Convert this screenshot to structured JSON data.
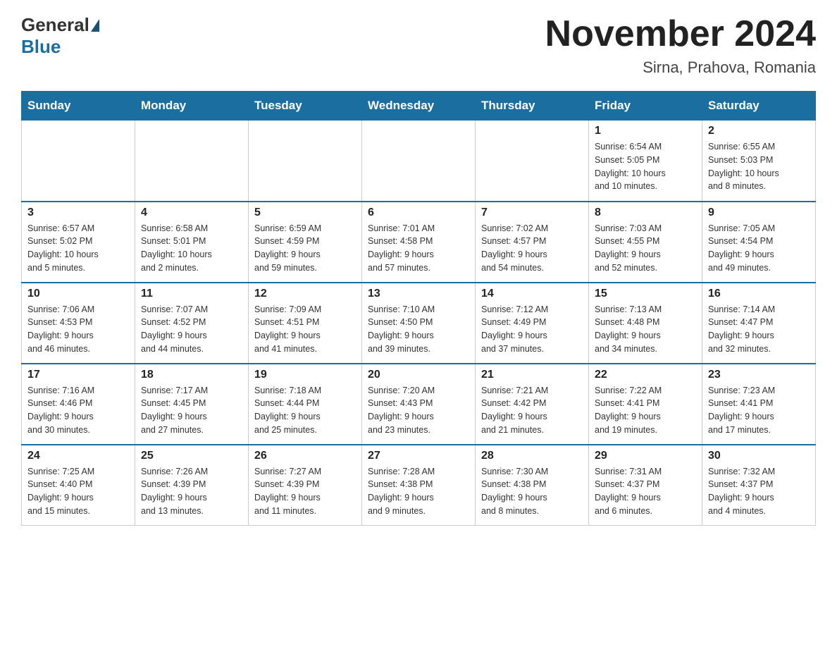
{
  "header": {
    "logo_general": "General",
    "logo_blue": "Blue",
    "month_title": "November 2024",
    "location": "Sirna, Prahova, Romania"
  },
  "days_of_week": [
    "Sunday",
    "Monday",
    "Tuesday",
    "Wednesday",
    "Thursday",
    "Friday",
    "Saturday"
  ],
  "weeks": [
    [
      {
        "day": "",
        "info": ""
      },
      {
        "day": "",
        "info": ""
      },
      {
        "day": "",
        "info": ""
      },
      {
        "day": "",
        "info": ""
      },
      {
        "day": "",
        "info": ""
      },
      {
        "day": "1",
        "info": "Sunrise: 6:54 AM\nSunset: 5:05 PM\nDaylight: 10 hours\nand 10 minutes."
      },
      {
        "day": "2",
        "info": "Sunrise: 6:55 AM\nSunset: 5:03 PM\nDaylight: 10 hours\nand 8 minutes."
      }
    ],
    [
      {
        "day": "3",
        "info": "Sunrise: 6:57 AM\nSunset: 5:02 PM\nDaylight: 10 hours\nand 5 minutes."
      },
      {
        "day": "4",
        "info": "Sunrise: 6:58 AM\nSunset: 5:01 PM\nDaylight: 10 hours\nand 2 minutes."
      },
      {
        "day": "5",
        "info": "Sunrise: 6:59 AM\nSunset: 4:59 PM\nDaylight: 9 hours\nand 59 minutes."
      },
      {
        "day": "6",
        "info": "Sunrise: 7:01 AM\nSunset: 4:58 PM\nDaylight: 9 hours\nand 57 minutes."
      },
      {
        "day": "7",
        "info": "Sunrise: 7:02 AM\nSunset: 4:57 PM\nDaylight: 9 hours\nand 54 minutes."
      },
      {
        "day": "8",
        "info": "Sunrise: 7:03 AM\nSunset: 4:55 PM\nDaylight: 9 hours\nand 52 minutes."
      },
      {
        "day": "9",
        "info": "Sunrise: 7:05 AM\nSunset: 4:54 PM\nDaylight: 9 hours\nand 49 minutes."
      }
    ],
    [
      {
        "day": "10",
        "info": "Sunrise: 7:06 AM\nSunset: 4:53 PM\nDaylight: 9 hours\nand 46 minutes."
      },
      {
        "day": "11",
        "info": "Sunrise: 7:07 AM\nSunset: 4:52 PM\nDaylight: 9 hours\nand 44 minutes."
      },
      {
        "day": "12",
        "info": "Sunrise: 7:09 AM\nSunset: 4:51 PM\nDaylight: 9 hours\nand 41 minutes."
      },
      {
        "day": "13",
        "info": "Sunrise: 7:10 AM\nSunset: 4:50 PM\nDaylight: 9 hours\nand 39 minutes."
      },
      {
        "day": "14",
        "info": "Sunrise: 7:12 AM\nSunset: 4:49 PM\nDaylight: 9 hours\nand 37 minutes."
      },
      {
        "day": "15",
        "info": "Sunrise: 7:13 AM\nSunset: 4:48 PM\nDaylight: 9 hours\nand 34 minutes."
      },
      {
        "day": "16",
        "info": "Sunrise: 7:14 AM\nSunset: 4:47 PM\nDaylight: 9 hours\nand 32 minutes."
      }
    ],
    [
      {
        "day": "17",
        "info": "Sunrise: 7:16 AM\nSunset: 4:46 PM\nDaylight: 9 hours\nand 30 minutes."
      },
      {
        "day": "18",
        "info": "Sunrise: 7:17 AM\nSunset: 4:45 PM\nDaylight: 9 hours\nand 27 minutes."
      },
      {
        "day": "19",
        "info": "Sunrise: 7:18 AM\nSunset: 4:44 PM\nDaylight: 9 hours\nand 25 minutes."
      },
      {
        "day": "20",
        "info": "Sunrise: 7:20 AM\nSunset: 4:43 PM\nDaylight: 9 hours\nand 23 minutes."
      },
      {
        "day": "21",
        "info": "Sunrise: 7:21 AM\nSunset: 4:42 PM\nDaylight: 9 hours\nand 21 minutes."
      },
      {
        "day": "22",
        "info": "Sunrise: 7:22 AM\nSunset: 4:41 PM\nDaylight: 9 hours\nand 19 minutes."
      },
      {
        "day": "23",
        "info": "Sunrise: 7:23 AM\nSunset: 4:41 PM\nDaylight: 9 hours\nand 17 minutes."
      }
    ],
    [
      {
        "day": "24",
        "info": "Sunrise: 7:25 AM\nSunset: 4:40 PM\nDaylight: 9 hours\nand 15 minutes."
      },
      {
        "day": "25",
        "info": "Sunrise: 7:26 AM\nSunset: 4:39 PM\nDaylight: 9 hours\nand 13 minutes."
      },
      {
        "day": "26",
        "info": "Sunrise: 7:27 AM\nSunset: 4:39 PM\nDaylight: 9 hours\nand 11 minutes."
      },
      {
        "day": "27",
        "info": "Sunrise: 7:28 AM\nSunset: 4:38 PM\nDaylight: 9 hours\nand 9 minutes."
      },
      {
        "day": "28",
        "info": "Sunrise: 7:30 AM\nSunset: 4:38 PM\nDaylight: 9 hours\nand 8 minutes."
      },
      {
        "day": "29",
        "info": "Sunrise: 7:31 AM\nSunset: 4:37 PM\nDaylight: 9 hours\nand 6 minutes."
      },
      {
        "day": "30",
        "info": "Sunrise: 7:32 AM\nSunset: 4:37 PM\nDaylight: 9 hours\nand 4 minutes."
      }
    ]
  ]
}
